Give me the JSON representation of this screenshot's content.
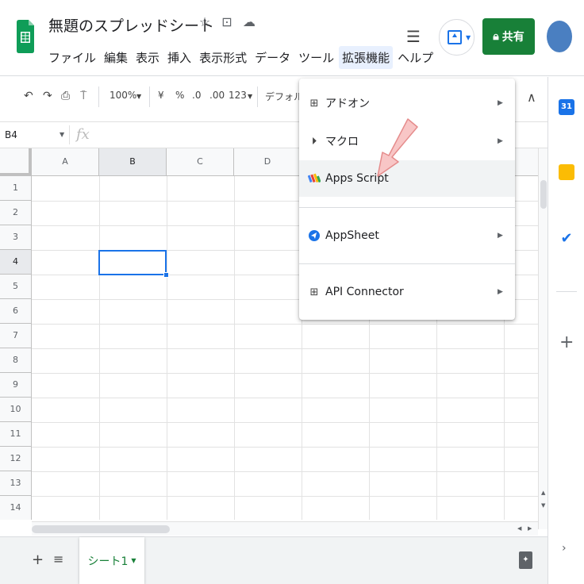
{
  "document": {
    "title": "無題のスプレッドシート"
  },
  "title_icons": [
    "star-icon",
    "move-to-folder-icon",
    "cloud-status-icon"
  ],
  "menubar": [
    "ファイル",
    "編集",
    "表示",
    "挿入",
    "表示形式",
    "データ",
    "ツール",
    "拡張機能",
    "ヘルプ"
  ],
  "menubar_active": "拡張機能",
  "share": {
    "label": "共有",
    "icon": "lock-icon"
  },
  "toolbar": {
    "zoom": "100%",
    "currency": "¥",
    "percent": "%",
    "decrease_decimal": ".0",
    "increase_decimal": ".00",
    "number_format": "123",
    "font": "デフォル"
  },
  "formula_bar": {
    "cell_ref": "B4",
    "fx": "fx"
  },
  "grid": {
    "columns": [
      "A",
      "B",
      "C",
      "D"
    ],
    "rows": [
      "1",
      "2",
      "3",
      "4",
      "5",
      "6",
      "7",
      "8",
      "9",
      "10",
      "11",
      "12",
      "13",
      "14"
    ],
    "selected_column": "B",
    "selected_row": "4"
  },
  "extensions_menu": {
    "items": [
      {
        "label": "アドオン",
        "icon": "addon-icon",
        "submenu": true
      },
      {
        "label": "マクロ",
        "icon": "macro-play-icon",
        "submenu": true
      },
      {
        "label": "Apps Script",
        "icon": "apps-script-icon",
        "submenu": false
      },
      {
        "label": "AppSheet",
        "icon": "appsheet-icon",
        "submenu": true
      },
      {
        "label": "API Connector",
        "icon": "api-connector-icon",
        "submenu": true
      }
    ]
  },
  "sheets": {
    "tab": "シート1"
  },
  "side_panel": {
    "apps": [
      {
        "icon": "calendar-icon",
        "text": "31",
        "color": "#1a73e8"
      },
      {
        "icon": "keep-icon",
        "text": "",
        "color": "#fbbc04"
      },
      {
        "icon": "tasks-icon",
        "text": "",
        "color": "#1a73e8"
      }
    ]
  },
  "colors": {
    "accent": "#1a73e8",
    "share": "#188038",
    "sheet_tab_text": "#188038",
    "annotation_arrow": "#f4b6b6"
  }
}
